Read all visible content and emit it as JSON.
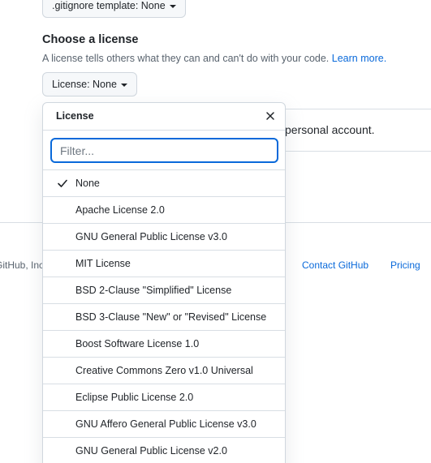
{
  "gitignore": {
    "button_label": ".gitignore template: None"
  },
  "license_section": {
    "title": "Choose a license",
    "description": "A license tells others what they can and can't do with your code.",
    "learn_more": "Learn more.",
    "button_label": "License: None"
  },
  "account_text": "personal account.",
  "footer": {
    "copyright": "GitHub, Inc.",
    "contact": "Contact GitHub",
    "pricing": "Pricing"
  },
  "dropdown": {
    "title": "License",
    "close_icon": "x-icon",
    "filter_placeholder": "Filter...",
    "filter_value": "",
    "selected": "None",
    "items": [
      {
        "label": "None",
        "selected": true
      },
      {
        "label": "Apache License 2.0",
        "selected": false
      },
      {
        "label": "GNU General Public License v3.0",
        "selected": false
      },
      {
        "label": "MIT License",
        "selected": false
      },
      {
        "label": "BSD 2-Clause \"Simplified\" License",
        "selected": false
      },
      {
        "label": "BSD 3-Clause \"New\" or \"Revised\" License",
        "selected": false
      },
      {
        "label": "Boost Software License 1.0",
        "selected": false
      },
      {
        "label": "Creative Commons Zero v1.0 Universal",
        "selected": false
      },
      {
        "label": "Eclipse Public License 2.0",
        "selected": false
      },
      {
        "label": "GNU Affero General Public License v3.0",
        "selected": false
      },
      {
        "label": "GNU General Public License v2.0",
        "selected": false
      }
    ]
  },
  "colors": {
    "link": "#0969da",
    "border": "#d0d7de",
    "button_bg": "#f6f8fa",
    "text": "#1f2328",
    "muted": "#59636e"
  }
}
